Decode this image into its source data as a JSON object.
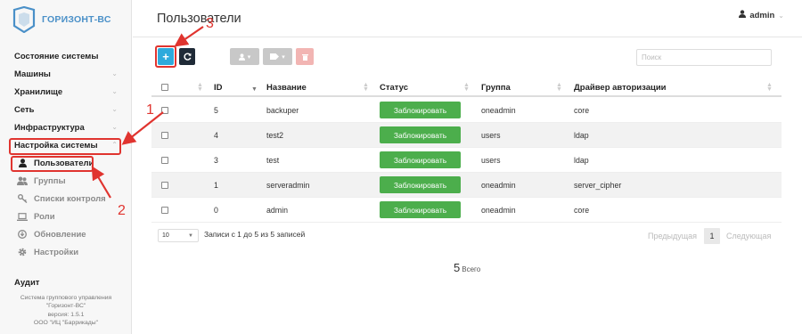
{
  "app": {
    "logo_text": "ГОРИЗОНТ-ВС"
  },
  "header": {
    "title": "Пользователи",
    "user": "admin"
  },
  "sidebar": {
    "items": [
      {
        "label": "Состояние системы"
      },
      {
        "label": "Машины"
      },
      {
        "label": "Хранилище"
      },
      {
        "label": "Сеть"
      },
      {
        "label": "Инфраструктура"
      },
      {
        "label": "Настройка системы"
      }
    ],
    "sub_items": [
      {
        "label": "Пользователи",
        "icon": "user-icon"
      },
      {
        "label": "Группы",
        "icon": "users-icon"
      },
      {
        "label": "Списки контроля",
        "icon": "key-icon"
      },
      {
        "label": "Роли",
        "icon": "laptop-icon"
      },
      {
        "label": "Обновление",
        "icon": "update-icon"
      },
      {
        "label": "Настройки",
        "icon": "gear-icon"
      }
    ],
    "audit": "Аудит",
    "footer": [
      "Система группового управления",
      "\"Горизонт-ВС\"",
      "версия: 1.5.1",
      "ООО \"ИЦ \"Баррикады\""
    ]
  },
  "toolbar": {
    "add_label": "+",
    "search_placeholder": "Поиск"
  },
  "table": {
    "columns": [
      "ID",
      "Название",
      "Статус",
      "Группа",
      "Драйвер авторизации"
    ],
    "rows": [
      {
        "id": "5",
        "name": "backuper",
        "status": "Заблокировать",
        "group": "oneadmin",
        "driver": "core"
      },
      {
        "id": "4",
        "name": "test2",
        "status": "Заблокировать",
        "group": "users",
        "driver": "ldap"
      },
      {
        "id": "3",
        "name": "test",
        "status": "Заблокировать",
        "group": "users",
        "driver": "ldap"
      },
      {
        "id": "1",
        "name": "serveradmin",
        "status": "Заблокировать",
        "group": "oneadmin",
        "driver": "server_cipher"
      },
      {
        "id": "0",
        "name": "admin",
        "status": "Заблокировать",
        "group": "oneadmin",
        "driver": "core"
      }
    ]
  },
  "pagination": {
    "page_size": "10",
    "info": "Записи с 1 до 5 из 5 записей",
    "prev": "Предыдущая",
    "page": "1",
    "next": "Следующая"
  },
  "summary": {
    "total": "5",
    "total_label": "Всего"
  },
  "annotations": [
    "1",
    "2",
    "3"
  ],
  "colors": {
    "accent": "#2eaadc",
    "success": "#4cae4c",
    "danger": "#e0342f",
    "logo": "#4a90c8"
  }
}
